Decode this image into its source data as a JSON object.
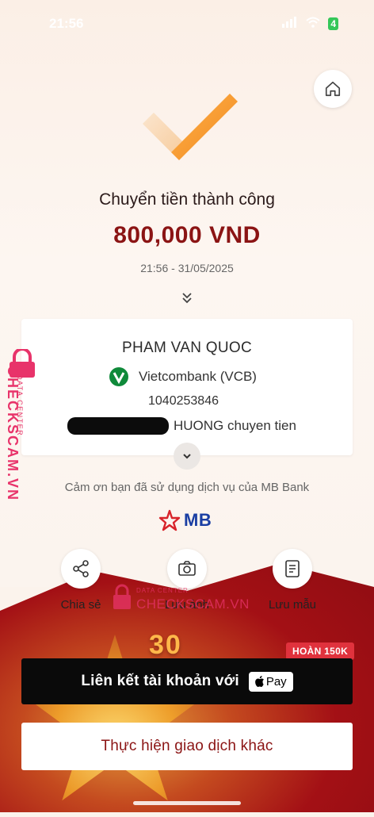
{
  "status_bar": {
    "time": "21:56",
    "battery": "4"
  },
  "colors": {
    "accent": "#8b1414",
    "brand_blue": "#1a3ea3",
    "watermark": "#e8336a"
  },
  "header": {
    "title": "Chuyển tiền thành công",
    "amount": "800,000 VND",
    "datetime": "21:56 - 31/05/2025"
  },
  "recipient": {
    "name": "PHAM VAN QUOC",
    "bank": "Vietcombank (VCB)",
    "account": "1040253846",
    "memo": "HUONG chuyen tien"
  },
  "thanks": "Cảm ơn bạn đã sử dụng dịch vụ của MB Bank",
  "brand": {
    "logo_text": "MB"
  },
  "actions": [
    {
      "label": "Chia sẻ",
      "icon": "share-icon"
    },
    {
      "label": "Lưu ảnh",
      "icon": "camera-icon"
    },
    {
      "label": "Lưu mẫu",
      "icon": "template-icon"
    }
  ],
  "promo": {
    "badge": "HOÀN 150K",
    "banner_number": "30"
  },
  "buttons": {
    "link_account": "Liên kết tài khoản với",
    "apple_pay": "Pay",
    "other_transaction": "Thực hiện giao dịch khác"
  },
  "watermark": {
    "site": "CHECKSCAM.VN",
    "tag": "DATA CENTER",
    "mid_site": "CHECKSCAM.VN"
  }
}
